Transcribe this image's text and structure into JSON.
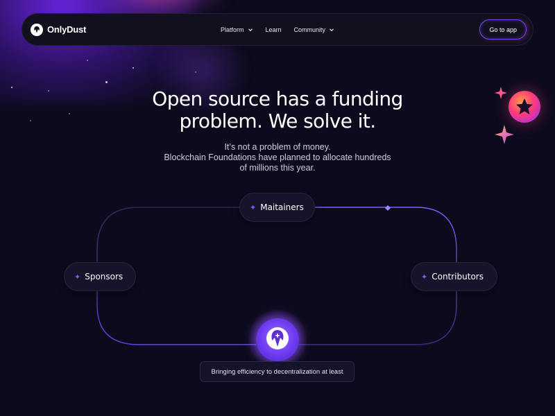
{
  "brand": {
    "name": "OnlyDust"
  },
  "nav": {
    "links": [
      {
        "label": "Platform",
        "has_dropdown": true
      },
      {
        "label": "Learn",
        "has_dropdown": false
      },
      {
        "label": "Community",
        "has_dropdown": true
      }
    ],
    "cta_label": "Go to app"
  },
  "hero": {
    "title_line1": "Open source has a funding",
    "title_line2": "problem. We solve it.",
    "subtitle_line1": "It’s not a problem of money.",
    "subtitle_line2": "Blockchain Foundations have planned to allocate hundreds",
    "subtitle_line3": "of millions this year."
  },
  "flow": {
    "maintainers_label": "Maitainers",
    "sponsors_label": "Sponsors",
    "contributors_label": "Contributors",
    "orb_icon": "onlydust-logo-icon",
    "tooltip_text": "Bringing efficiency to decentralization at least"
  },
  "colors": {
    "background": "#0c0a1c",
    "accent_purple": "#7d5cff",
    "accent_pink": "#ff3a7a",
    "accent_orange": "#ff9a4a"
  }
}
